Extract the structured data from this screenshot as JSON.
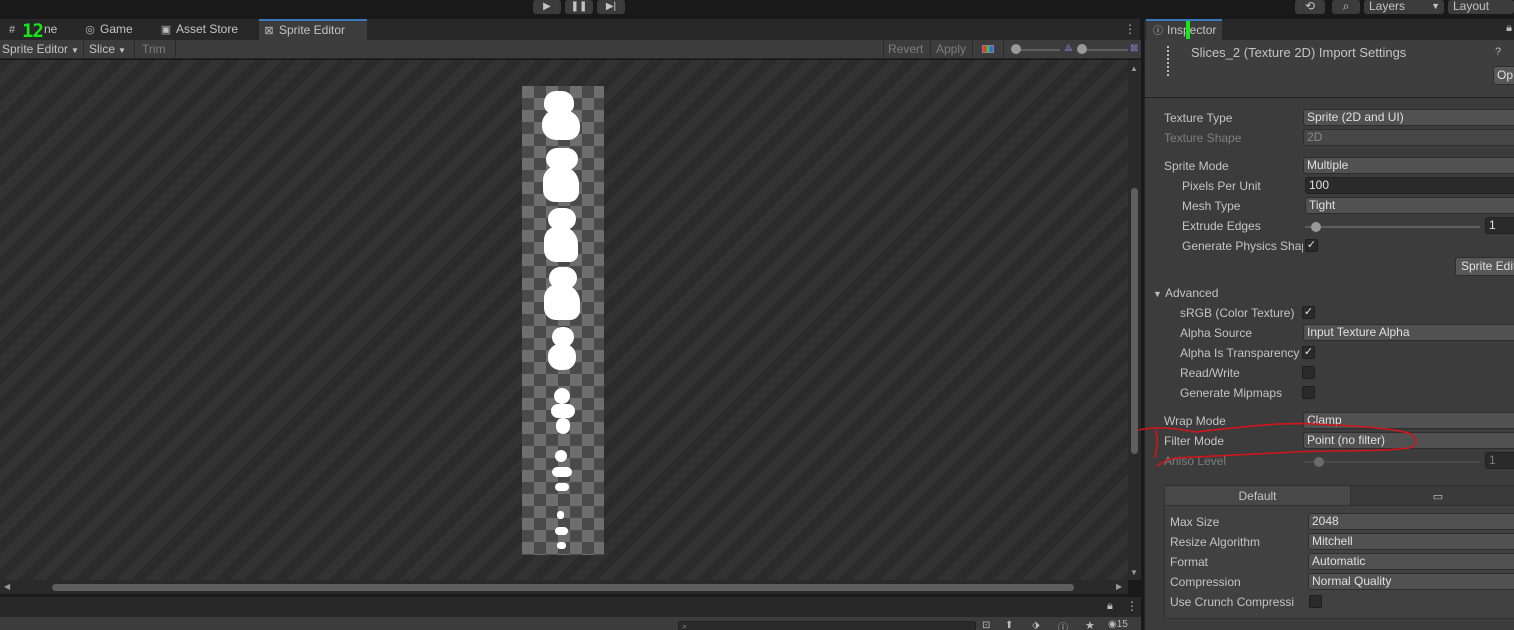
{
  "top_toolbar": {
    "play_icon": "play-icon",
    "pause_icon": "pause-icon",
    "step_icon": "step-icon",
    "history_icon": "history-icon",
    "search_icon": "search-icon",
    "layers_label": "Layers",
    "layout_label": "Layout"
  },
  "tabs": {
    "scene_label": "Scene",
    "scene_visible": "ne",
    "game_label": "Game",
    "asset_store_label": "Asset Store",
    "sprite_editor_label": "Sprite Editor"
  },
  "overlay": {
    "green_text": "12"
  },
  "sprite_editor_toolbar": {
    "mode_label": "Sprite Editor",
    "slice_label": "Slice",
    "trim_label": "Trim",
    "revert_label": "Revert",
    "apply_label": "Apply"
  },
  "inspector": {
    "tab_label": "Inspector",
    "title": "Slices_2 (Texture 2D) Import Settings",
    "open_label": "Op",
    "texture_type": {
      "label": "Texture Type",
      "value": "Sprite (2D and UI)"
    },
    "texture_shape": {
      "label": "Texture Shape",
      "value": "2D"
    },
    "sprite_mode": {
      "label": "Sprite Mode",
      "value": "Multiple"
    },
    "pixels_per_unit": {
      "label": "Pixels Per Unit",
      "value": "100"
    },
    "mesh_type": {
      "label": "Mesh Type",
      "value": "Tight"
    },
    "extrude_edges": {
      "label": "Extrude Edges",
      "value": "1"
    },
    "generate_physics_shape": {
      "label": "Generate Physics Shape",
      "checked": true
    },
    "sprite_editor_button": "Sprite Editor",
    "advanced_label": "Advanced",
    "srgb": {
      "label": "sRGB (Color Texture)",
      "checked": true
    },
    "alpha_source": {
      "label": "Alpha Source",
      "value": "Input Texture Alpha"
    },
    "alpha_is_transparency": {
      "label": "Alpha Is Transparency",
      "checked": true
    },
    "read_write": {
      "label": "Read/Write",
      "checked": false
    },
    "generate_mipmaps": {
      "label": "Generate Mipmaps",
      "checked": false
    },
    "wrap_mode": {
      "label": "Wrap Mode",
      "value": "Clamp"
    },
    "filter_mode": {
      "label": "Filter Mode",
      "value": "Point (no filter)"
    },
    "aniso_level": {
      "label": "Aniso Level",
      "value": "1"
    },
    "platform_tabs": {
      "default_label": "Default",
      "pc_icon": "monitor-icon"
    },
    "max_size": {
      "label": "Max Size",
      "value": "2048"
    },
    "resize_algorithm": {
      "label": "Resize Algorithm",
      "value": "Mitchell"
    },
    "format": {
      "label": "Format",
      "value": "Automatic"
    },
    "compression": {
      "label": "Compression",
      "value": "Normal Quality"
    },
    "use_crunch": {
      "label": "Use Crunch Compression",
      "checked": false
    }
  },
  "bottom": {
    "search_value": "",
    "count": "15"
  },
  "colors": {
    "accent": "#3a79bb",
    "annotation": "#d0161c",
    "overlay_green": "#19e619"
  }
}
